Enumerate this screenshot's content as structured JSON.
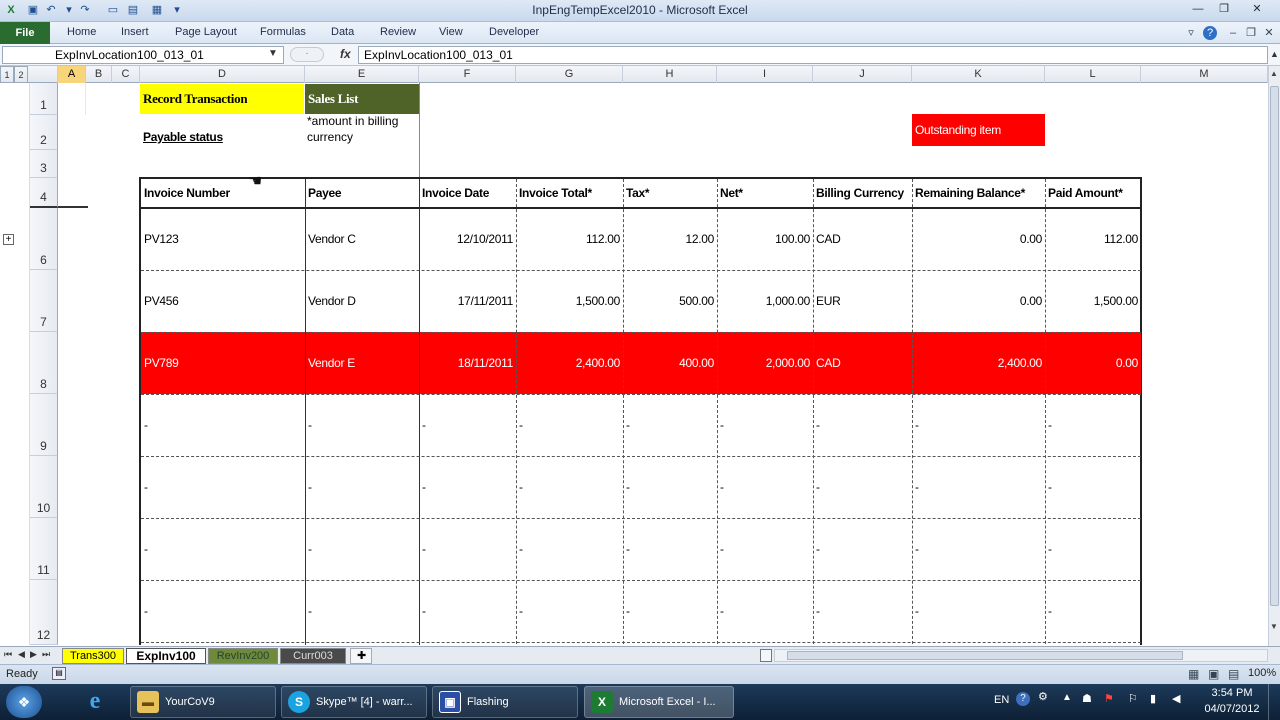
{
  "window": {
    "title": "InpEngTempExcel2010  -  Microsoft Excel"
  },
  "ribbon": {
    "tabs": [
      "File",
      "Home",
      "Insert",
      "Page Layout",
      "Formulas",
      "Data",
      "Review",
      "View",
      "Developer"
    ]
  },
  "formula_bar": {
    "name_box": "ExpInvLocation100_013_01",
    "fx": "fx",
    "formula": "ExpInvLocation100_013_01"
  },
  "outline_levels": [
    "1",
    "2"
  ],
  "columns": [
    "A",
    "B",
    "C",
    "D",
    "E",
    "F",
    "G",
    "H",
    "I",
    "J",
    "K",
    "L",
    "M"
  ],
  "rows": [
    "1",
    "2",
    "3",
    "4",
    "6",
    "7",
    "8",
    "9",
    "10",
    "11",
    "12"
  ],
  "sheet": {
    "record_transaction": "Record Transaction",
    "sales_list": "Sales List",
    "payable_status": "Payable status",
    "amount_note": "*amount in billing currency",
    "outstanding_item": "Outstanding item",
    "table": {
      "headers": [
        "Invoice Number",
        "Payee",
        "Invoice Date",
        "Invoice Total*",
        "Tax*",
        "Net*",
        "Billing Currency",
        "Remaining Balance*",
        "Paid Amount*"
      ],
      "rows": [
        [
          "PV123",
          "Vendor C",
          "12/10/2011",
          "112.00",
          "12.00",
          "100.00",
          "CAD",
          "0.00",
          "112.00"
        ],
        [
          "PV456",
          "Vendor D",
          "17/11/2011",
          "1,500.00",
          "500.00",
          "1,000.00",
          "EUR",
          "0.00",
          "1,500.00"
        ],
        [
          "PV789",
          "Vendor E",
          "18/11/2011",
          "2,400.00",
          "400.00",
          "2,000.00",
          "CAD",
          "2,400.00",
          "0.00"
        ]
      ],
      "empty_marker": "-"
    }
  },
  "sheet_tabs": [
    "Trans300",
    "ExpInv100",
    "RevInv200",
    "Curr003"
  ],
  "status": {
    "ready": "Ready",
    "zoom": "100%"
  },
  "taskbar": {
    "items": [
      "YourCoV9",
      "Skype™ [4] - warr...",
      "Flashing",
      "Microsoft Excel - I..."
    ],
    "language": "EN",
    "time": "3:54 PM",
    "date": "04/07/2012"
  },
  "colors": {
    "yellow": "#ffff00",
    "olive": "#4f6228",
    "red": "#ff0000",
    "file_tab": "#2a6c2f"
  }
}
